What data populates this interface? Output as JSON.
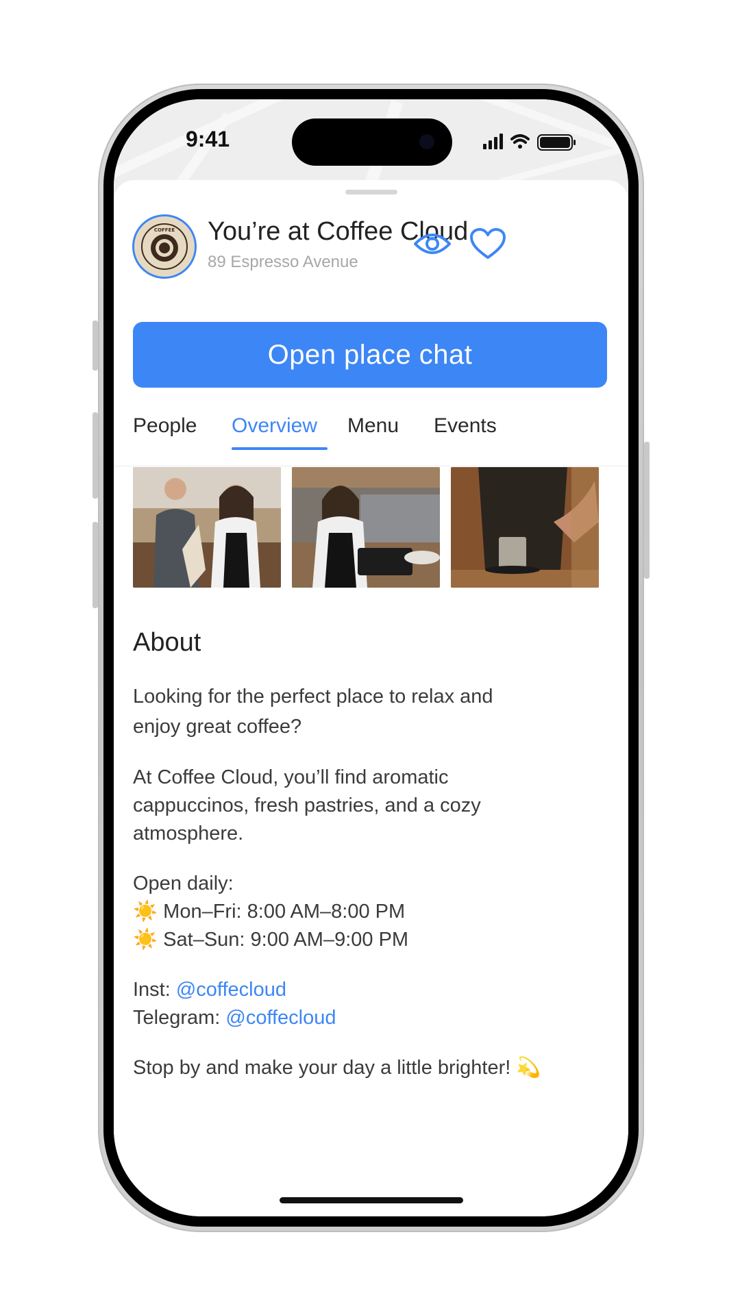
{
  "status_bar": {
    "time": "9:41"
  },
  "place": {
    "title": "You’re at Coffee Cloud",
    "address": "89 Espresso Avenue",
    "logo_text": "COFFEE"
  },
  "actions": {
    "view_icon": "eye-icon",
    "favorite_icon": "heart-icon"
  },
  "chat_button": {
    "label": "Open place chat"
  },
  "tabs": [
    {
      "label": "People",
      "active": false
    },
    {
      "label": "Overview",
      "active": true
    },
    {
      "label": "Menu",
      "active": false
    },
    {
      "label": "Events",
      "active": false
    }
  ],
  "photos": [
    {
      "description_icon": "photo"
    },
    {
      "description_icon": "photo"
    },
    {
      "description_icon": "photo"
    }
  ],
  "about": {
    "heading": "About",
    "intro_line1": "Looking for the perfect place to relax and",
    "intro_line2": "enjoy great coffee?",
    "detail_line1": "At Coffee Cloud, you’ll find aromatic",
    "detail_line2": "cappuccinos, fresh pastries, and a cozy",
    "detail_line3": "atmosphere.",
    "hours_title": "Open daily:",
    "hours_weekday": "☀️ Mon–Fri: 8:00 AM–8:00 PM",
    "hours_weekend": "☀️ Sat–Sun: 9:00 AM–9:00 PM",
    "inst_label": "Inst: ",
    "inst_handle": "@coffecloud",
    "telegram_label": "Telegram: ",
    "telegram_handle": "@coffecloud",
    "closing": "Stop by and make your day a little brighter! 💫"
  },
  "colors": {
    "accent": "#3d86f5",
    "text_primary": "#222222",
    "text_secondary": "#a7a7a7"
  }
}
